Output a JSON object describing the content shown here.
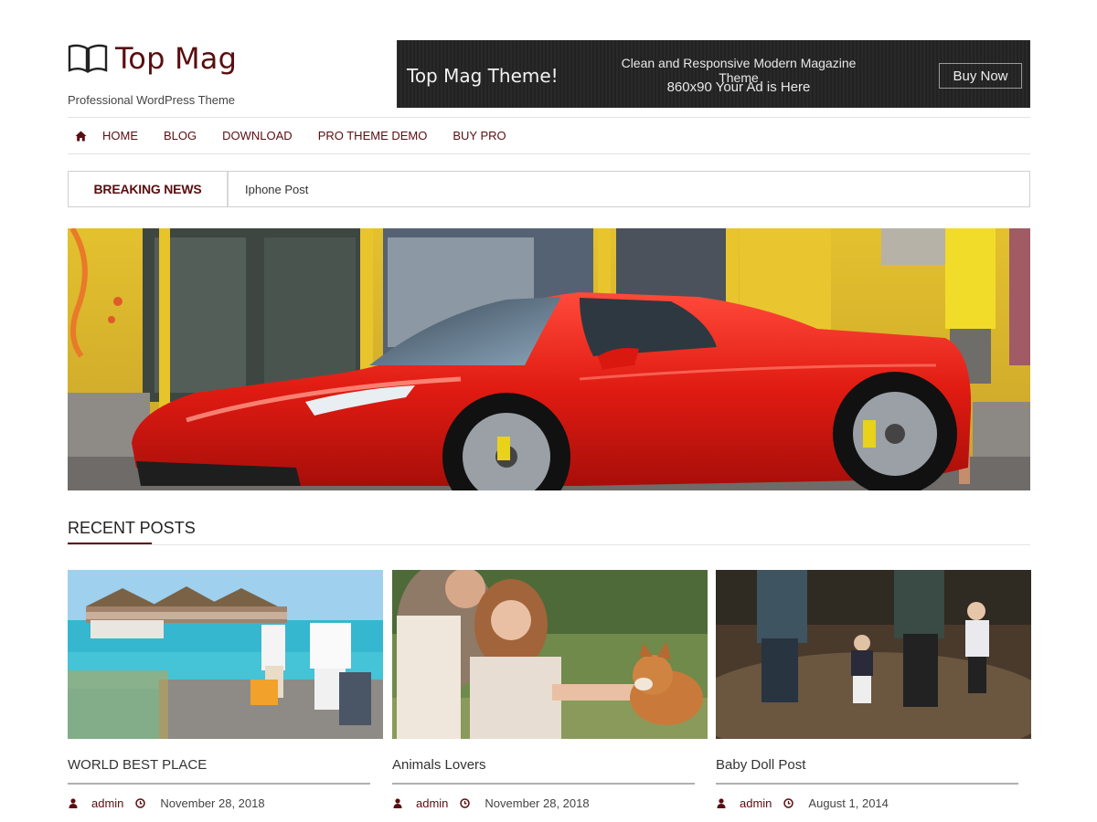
{
  "site": {
    "logo_text": "Top Mag",
    "tagline": "Professional WordPress Theme"
  },
  "ad": {
    "title": "Top Mag Theme!",
    "line1": "Clean and Responsive Modern Magazine Theme",
    "line2": "860x90 Your Ad is Here",
    "button": "Buy Now"
  },
  "nav": {
    "home_icon": "home-icon",
    "items": [
      {
        "label": "HOME"
      },
      {
        "label": "BLOG"
      },
      {
        "label": "DOWNLOAD"
      },
      {
        "label": "PRO THEME DEMO"
      },
      {
        "label": "BUY PRO"
      }
    ]
  },
  "breaking": {
    "label": "BREAKING NEWS",
    "text": "Iphone Post"
  },
  "recent": {
    "title": "RECENT POSTS",
    "posts": [
      {
        "title": "WORLD BEST PLACE",
        "author": "admin",
        "date": "November 28, 2018"
      },
      {
        "title": "Animals Lovers",
        "author": "admin",
        "date": "November 28, 2018"
      },
      {
        "title": "Baby Doll Post",
        "author": "admin",
        "date": "August 1, 2014"
      }
    ]
  },
  "colors": {
    "brand": "#5a0e10",
    "ad_bg": "#222222",
    "border": "#e2e2e2"
  }
}
